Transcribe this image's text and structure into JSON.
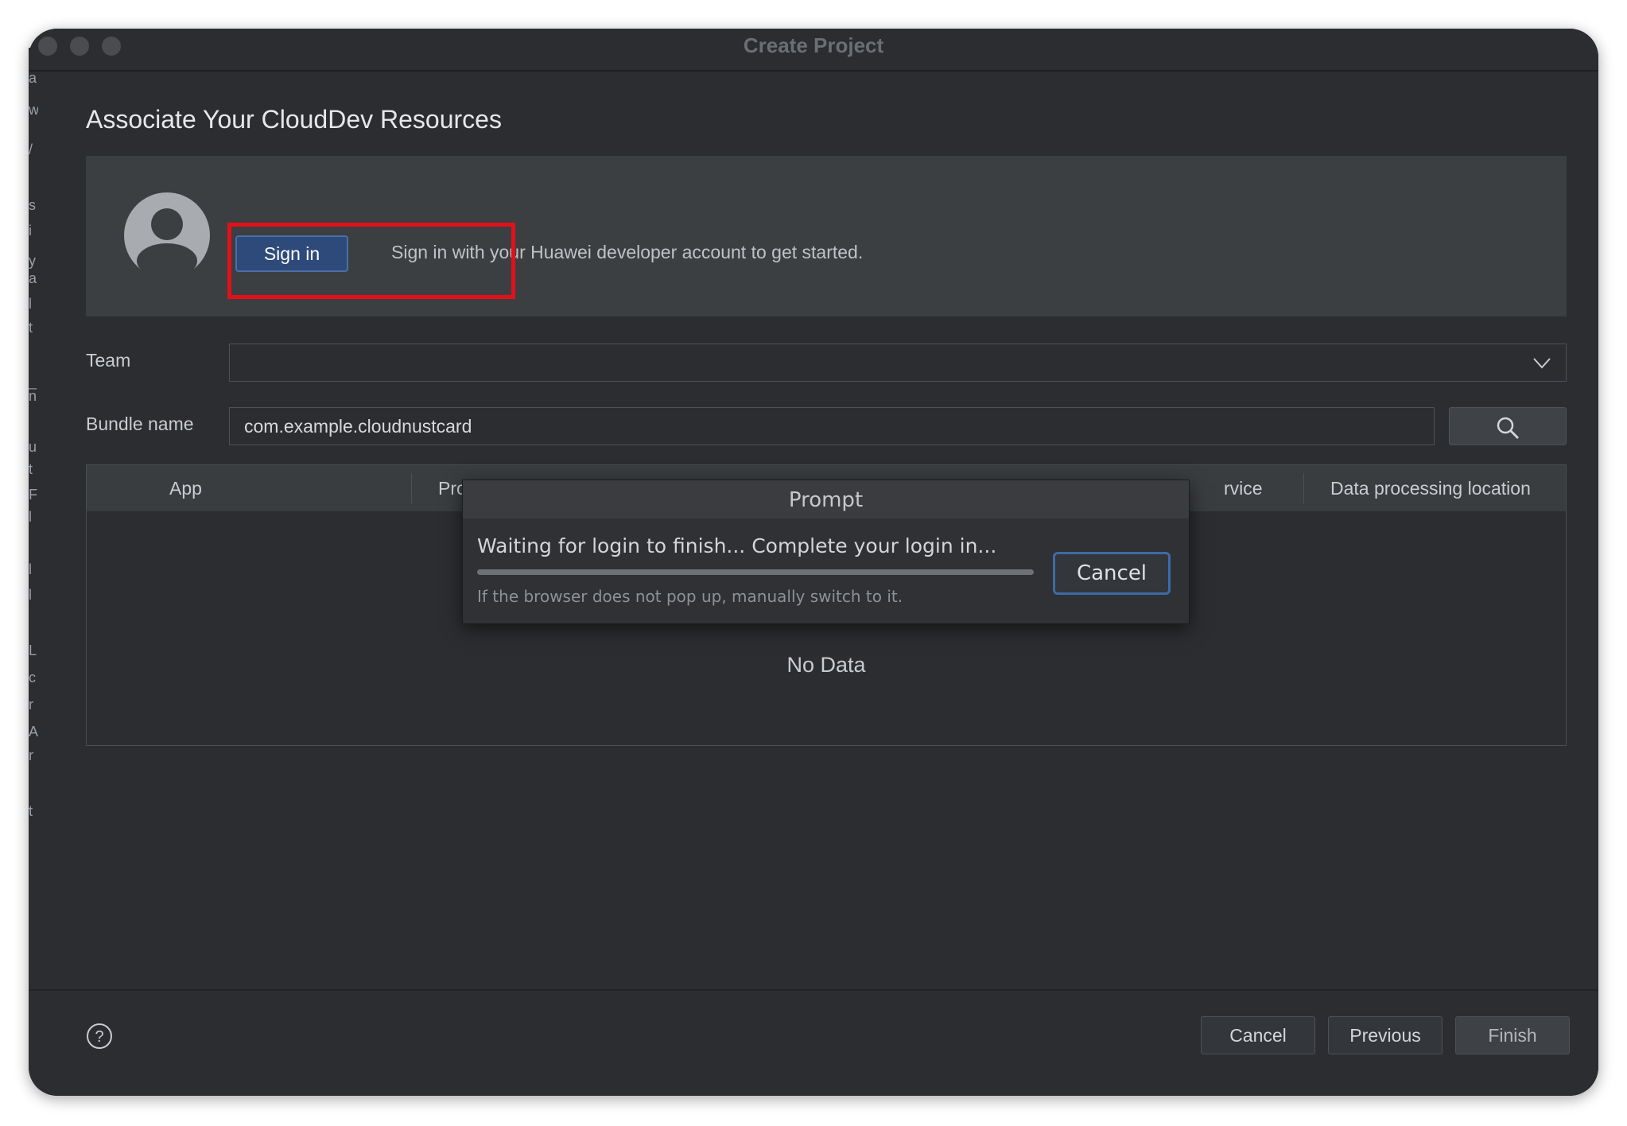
{
  "window": {
    "title": "Create Project"
  },
  "page": {
    "heading": "Associate Your CloudDev Resources"
  },
  "signin": {
    "button_label": "Sign in",
    "description": "Sign in with your Huawei developer account to get started."
  },
  "form": {
    "team_label": "Team",
    "team_value": "",
    "bundle_label": "Bundle name",
    "bundle_value": "com.example.cloudnustcard"
  },
  "table": {
    "columns": [
      "App",
      "Pro",
      "rvice",
      "Data processing location"
    ],
    "empty_text": "No Data"
  },
  "prompt": {
    "title": "Prompt",
    "message": "Waiting for login to finish... Complete your login in...",
    "hint": "If the browser does not pop up, manually switch to it.",
    "cancel_label": "Cancel",
    "progress": 1.0
  },
  "footer": {
    "cancel_label": "Cancel",
    "previous_label": "Previous",
    "finish_label": "Finish"
  },
  "background_ide": {
    "chars": [
      "a",
      "w",
      "/",
      "s",
      "i",
      "y",
      "a",
      "l",
      "t",
      "_",
      "n",
      "u",
      "t",
      "F",
      "l",
      "l",
      "l",
      "L",
      "c",
      "r",
      "A",
      "r",
      "t"
    ]
  },
  "colors": {
    "window_bg": "#2b2d30",
    "accent_blue": "#2e4a7a",
    "highlight_red": "#e3101a"
  },
  "icons": {
    "search": "search-icon",
    "dropdown": "chevron-down-icon",
    "help": "help-icon",
    "avatar": "user-avatar-icon"
  }
}
